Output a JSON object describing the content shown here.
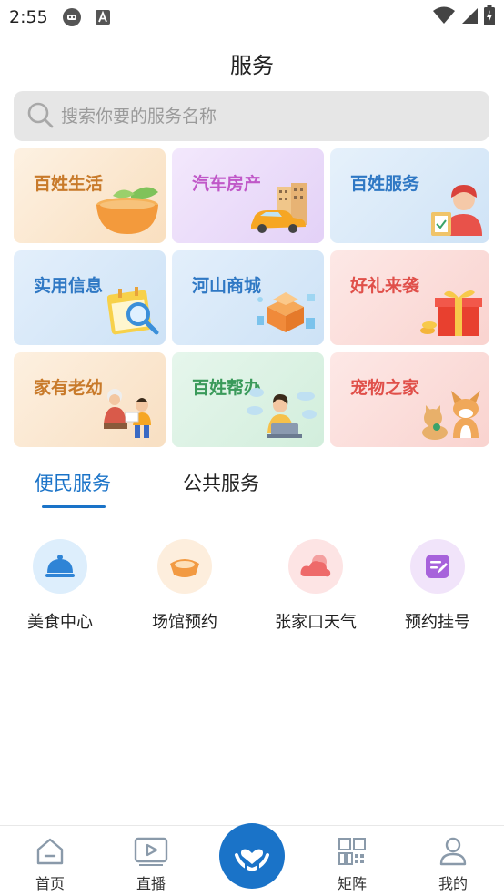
{
  "status_bar": {
    "time": "2:55"
  },
  "page": {
    "title": "服务"
  },
  "search": {
    "placeholder": "搜索你要的服务名称"
  },
  "tiles": [
    {
      "label": "百姓生活",
      "color": "#c87a2a",
      "bg": "#fbe8d0",
      "icon": "food-bowl-icon"
    },
    {
      "label": "汽车房产",
      "color": "#c058c8",
      "bg": "#ecdcf8",
      "icon": "car-building-icon"
    },
    {
      "label": "百姓服务",
      "color": "#2f78c4",
      "bg": "#d9eaf8",
      "icon": "service-person-icon"
    },
    {
      "label": "实用信息",
      "color": "#2f78c4",
      "bg": "#d6e9f8",
      "icon": "calendar-search-icon"
    },
    {
      "label": "河山商城",
      "color": "#2f78c4",
      "bg": "#d6e9f8",
      "icon": "shop-isometric-icon"
    },
    {
      "label": "好礼来袭",
      "color": "#e0504a",
      "bg": "#fbdedb",
      "icon": "gift-box-icon"
    },
    {
      "label": "家有老幼",
      "color": "#c87a2a",
      "bg": "#fbe6d0",
      "icon": "elder-child-icon"
    },
    {
      "label": "百姓帮办",
      "color": "#3a9a5a",
      "bg": "#dcf2e4",
      "icon": "helper-laptop-icon"
    },
    {
      "label": "宠物之家",
      "color": "#e0504a",
      "bg": "#fbdedb",
      "icon": "pets-icon"
    }
  ],
  "tabs": [
    {
      "label": "便民服务",
      "active": true
    },
    {
      "label": "公共服务",
      "active": false
    }
  ],
  "services": [
    {
      "label": "美食中心",
      "bg": "#ddeefc",
      "icon": "dish-cover-icon"
    },
    {
      "label": "场馆预约",
      "bg": "#fdeedd",
      "icon": "venue-icon"
    },
    {
      "label": "张家口天气",
      "bg": "#fde4e4",
      "icon": "weather-icon"
    },
    {
      "label": "预约挂号",
      "bg": "#f1e4fa",
      "icon": "register-icon"
    }
  ],
  "bottom_nav": [
    {
      "label": "首页",
      "icon": "home-icon"
    },
    {
      "label": "直播",
      "icon": "live-play-icon"
    },
    {
      "label": "",
      "icon": "heart-hands-icon"
    },
    {
      "label": "矩阵",
      "icon": "matrix-grid-icon"
    },
    {
      "label": "我的",
      "icon": "profile-icon"
    }
  ],
  "colors": {
    "accent": "#1a73c8"
  }
}
